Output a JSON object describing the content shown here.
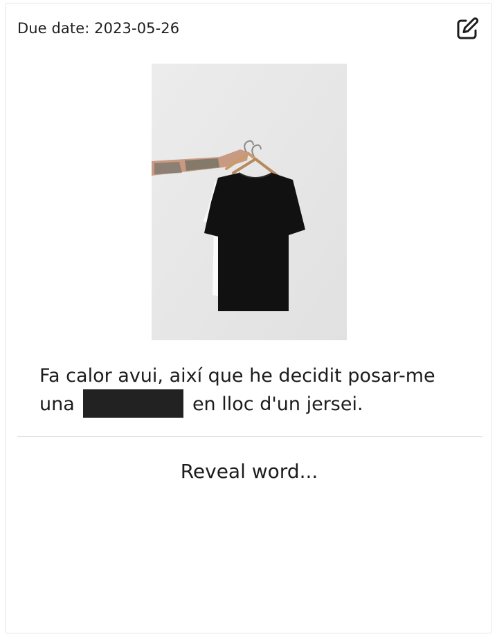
{
  "card": {
    "due_date_label": "Due date: 2023-05-26",
    "edit_icon": "edit-square-pencil-icon",
    "image": {
      "subject": "black t-shirt on hanger"
    },
    "sentence": {
      "before": "Fa calor avui, així que he decidit posar-me una ",
      "after": " en lloc d'un jersei."
    },
    "reveal_label": "Reveal word..."
  },
  "colors": {
    "text": "#1c1c1c",
    "hidden_word_block": "#222222",
    "divider": "#d6d6d6",
    "photo_background": "#e9e9e9"
  }
}
